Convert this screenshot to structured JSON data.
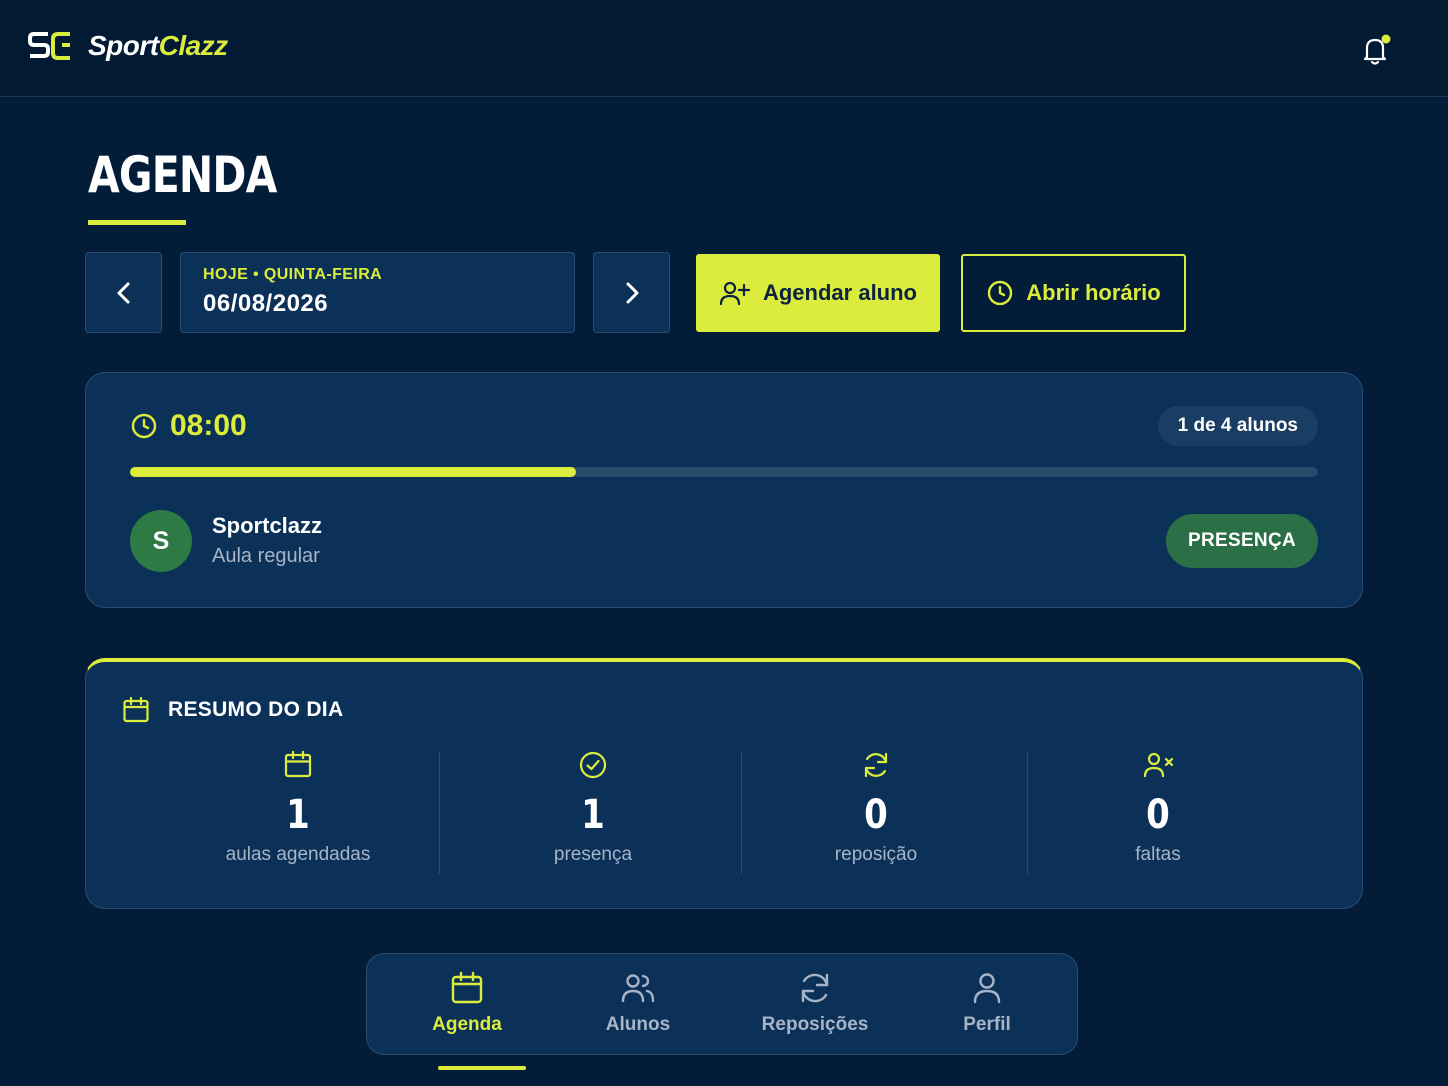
{
  "header": {
    "logo_sport": "Sport",
    "logo_clazz": "Clazz",
    "notification_dot_color": "#dbec3c"
  },
  "page": {
    "title": "AGENDA"
  },
  "date_nav": {
    "label": "HOJE • QUINTA-FEIRA",
    "date": "06/08/2026",
    "prev_icon": "chevron-left-icon",
    "next_icon": "chevron-right-icon"
  },
  "actions": {
    "schedule_label": "Agendar aluno",
    "open_slot_label": "Abrir horário"
  },
  "slot": {
    "time": "08:00",
    "capacity_text": "1 de 4 alunos",
    "fill_fraction": 0.375,
    "students": [
      {
        "initial": "S",
        "name": "Sportclazz",
        "type": "Aula regular",
        "status": "PRESENÇA"
      }
    ]
  },
  "summary": {
    "title": "RESUMO DO DIA",
    "stats": [
      {
        "icon": "calendar-icon",
        "value": "1",
        "label": "aulas agendadas"
      },
      {
        "icon": "check-circle-icon",
        "value": "1",
        "label": "presença"
      },
      {
        "icon": "refresh-icon",
        "value": "0",
        "label": "reposição"
      },
      {
        "icon": "user-x-icon",
        "value": "0",
        "label": "faltas"
      }
    ]
  },
  "bottom_nav": {
    "tabs": [
      {
        "label": "Agenda",
        "icon": "calendar-icon",
        "active": true
      },
      {
        "label": "Alunos",
        "icon": "users-icon",
        "active": false
      },
      {
        "label": "Reposições",
        "icon": "refresh-icon",
        "active": false
      },
      {
        "label": "Perfil",
        "icon": "user-icon",
        "active": false
      }
    ]
  },
  "colors": {
    "background": "#031c38",
    "card": "#0c3158",
    "accent": "#dbec3c",
    "success": "#2b6f47"
  }
}
